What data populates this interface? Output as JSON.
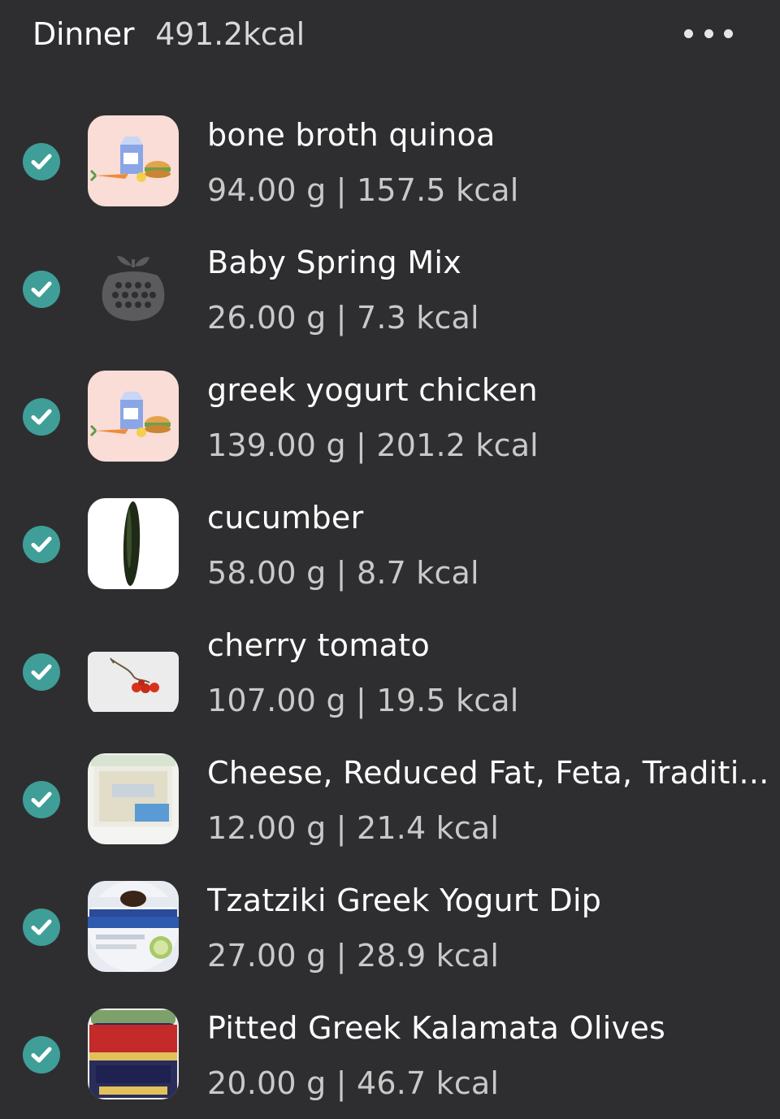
{
  "meal": {
    "title": "Dinner",
    "total": "491.2kcal"
  },
  "colors": {
    "background": "#2e2e30",
    "check": "#3f9e98"
  },
  "items": [
    {
      "name": "bone broth quinoa",
      "detail": "94.00 g | 157.5 kcal",
      "icon": "recipe-icon"
    },
    {
      "name": "Baby Spring Mix",
      "detail": "26.00 g | 7.3 kcal",
      "icon": "food-basket-icon"
    },
    {
      "name": "greek yogurt chicken",
      "detail": "139.00 g | 201.2 kcal",
      "icon": "recipe-icon"
    },
    {
      "name": "cucumber",
      "detail": "58.00 g | 8.7 kcal",
      "icon": "cucumber-photo"
    },
    {
      "name": "cherry tomato",
      "detail": "107.00 g | 19.5 kcal",
      "icon": "cherry-tomato-photo"
    },
    {
      "name": "Cheese, Reduced Fat, Feta, Traditi...",
      "detail": "12.00 g | 21.4 kcal",
      "icon": "feta-package-photo"
    },
    {
      "name": "Tzatziki Greek Yogurt Dip",
      "detail": "27.00 g | 28.9 kcal",
      "icon": "tzatziki-package-photo"
    },
    {
      "name": "Pitted Greek Kalamata Olives",
      "detail": "20.00 g | 46.7 kcal",
      "icon": "olives-jar-photo"
    }
  ]
}
